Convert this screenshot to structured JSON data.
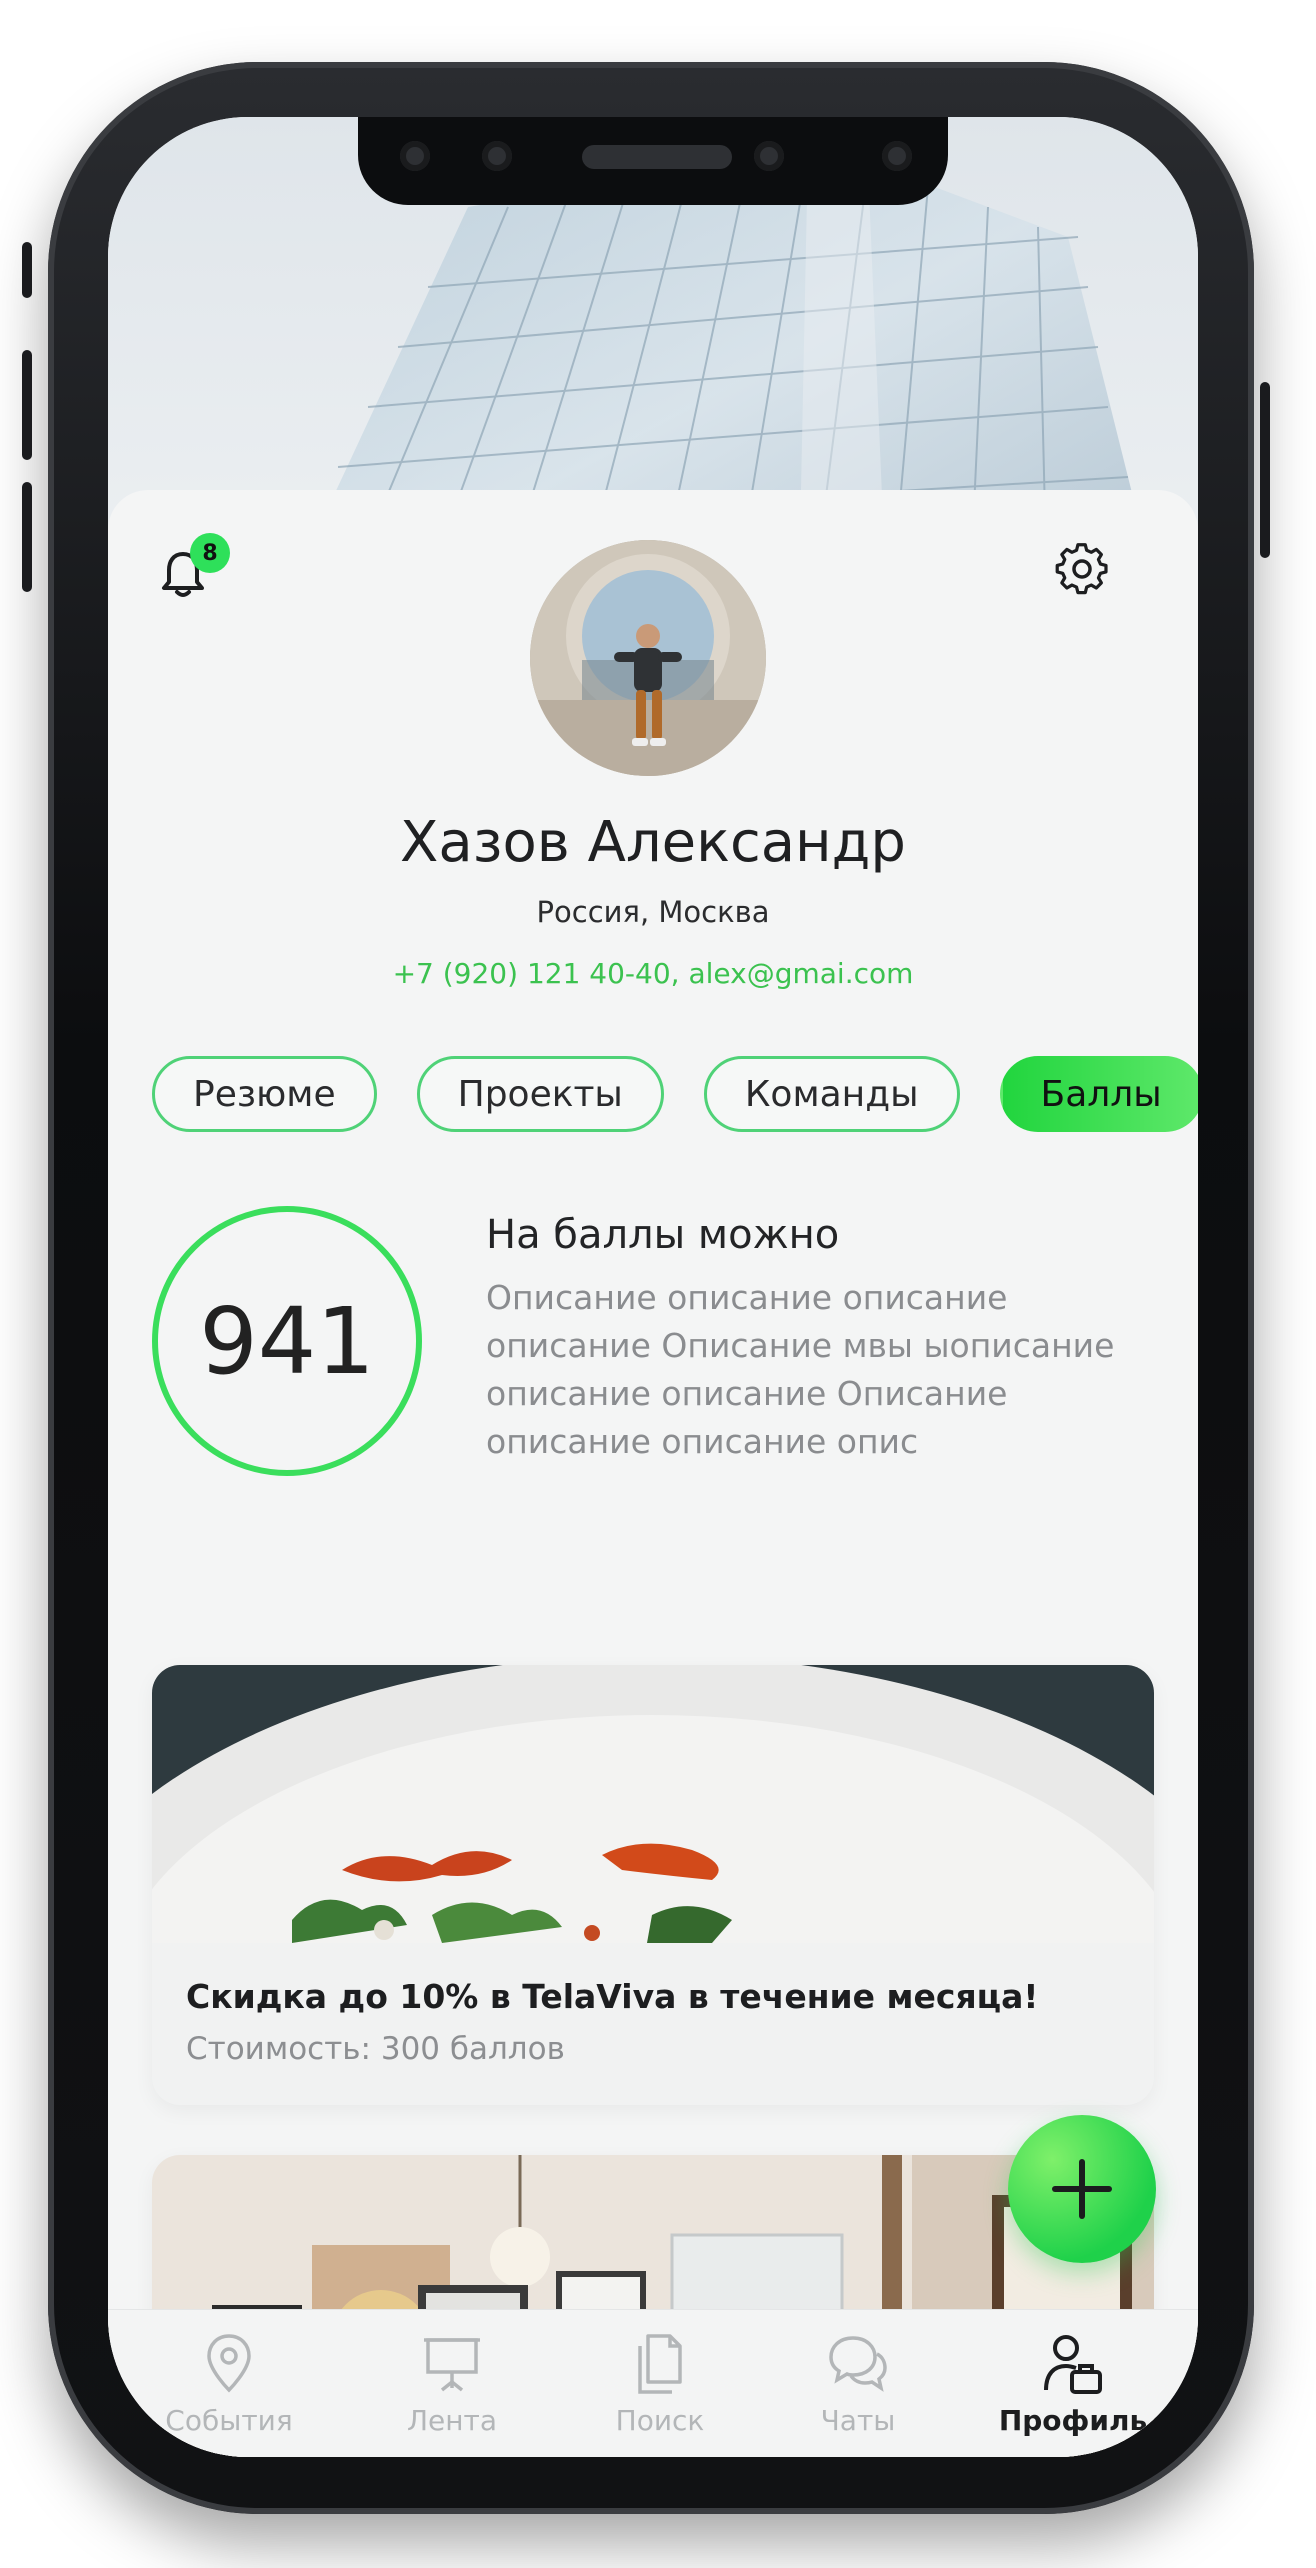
{
  "notifications": {
    "count": "8"
  },
  "profile": {
    "name": "Хазов Александр",
    "location": "Россия, Москва",
    "phone": "+7 (920) 121 40-40",
    "separator": ", ",
    "email": "alex@gmai.com"
  },
  "tabs": [
    {
      "label": "Резюме",
      "active": false
    },
    {
      "label": "Проекты",
      "active": false
    },
    {
      "label": "Команды",
      "active": false
    },
    {
      "label": "Баллы",
      "active": true
    }
  ],
  "points": {
    "value": "941",
    "title": "На баллы можно",
    "description": "Описание описание описание описание Описание мвы ыописание описание описание Описание описание описание опис"
  },
  "offers": [
    {
      "title": "Скидка до 10% в TelaViva в течение месяца!",
      "price": "Стоимость: 300 баллов"
    }
  ],
  "tabbar": [
    {
      "label": "События",
      "icon": "map-pin-icon",
      "active": false
    },
    {
      "label": "Лента",
      "icon": "presentation-board-icon",
      "active": false
    },
    {
      "label": "Поиск",
      "icon": "documents-icon",
      "active": false
    },
    {
      "label": "Чаты",
      "icon": "chat-bubbles-icon",
      "active": false
    },
    {
      "label": "Профиль",
      "icon": "profile-briefcase-icon",
      "active": true
    }
  ],
  "colors": {
    "accent": "#2ee05a",
    "text": "#1f2022",
    "muted": "#8a8c8f"
  }
}
